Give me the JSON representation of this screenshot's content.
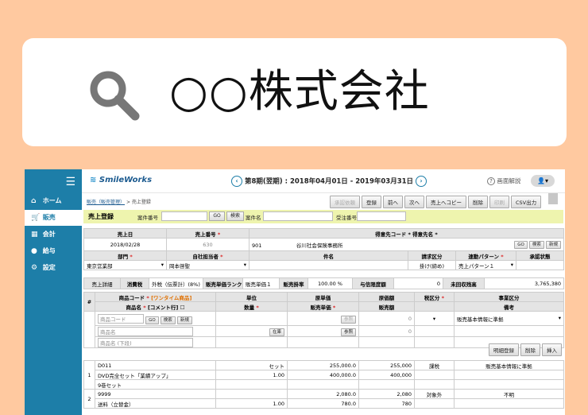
{
  "search": {
    "text": "○○株式会社",
    "icon": "search-icon"
  },
  "sidebar": {
    "items": [
      {
        "label": "ホーム",
        "icon": "home-icon"
      },
      {
        "label": "販売",
        "icon": "cart-icon"
      },
      {
        "label": "会計",
        "icon": "calculator-icon"
      },
      {
        "label": "給与",
        "icon": "money-bag-icon"
      },
      {
        "label": "設定",
        "icon": "gear-icon"
      }
    ]
  },
  "header": {
    "logo": "SmileWorks",
    "period": "第8期(翌期) : 2018年04月01日 - 2019年03月31日",
    "help": "画面解説"
  },
  "breadcrumb": {
    "link": "販売（販売管理）",
    "current": "> 売上登録"
  },
  "toolbar": [
    "承認依頼",
    "登録",
    "前へ",
    "次へ",
    "売上へコピー",
    "削除",
    "印刷",
    "CSV出力"
  ],
  "form": {
    "title": "売上登録",
    "case_no_label": "案件番号",
    "go": "GO",
    "search": "検索",
    "case_name_label": "案件名",
    "order_no_label": "受注番号",
    "sales_date_label": "売上日",
    "sales_date": "2018/02/28",
    "sales_no_label": "売上番号",
    "sales_no": "630",
    "customer_label": "得意先コード * 得意先名 *",
    "customer_code": "901",
    "customer_name": "谷川社会保険事務所",
    "new": "新規",
    "dept_label": "部門",
    "dept": "東京営業部",
    "staff_label": "自社担当者",
    "staff": "岡本啓聖",
    "subject_label": "件名",
    "billing_label": "請求区分",
    "billing": "掛け(締め)",
    "pattern_label": "連動パターン",
    "pattern": "売上パターン１",
    "approval_label": "承認状態",
    "detail_btn": "売上詳細",
    "tax_label": "消費税",
    "tax_value": "外税（伝票計）(8%)",
    "rank_label": "販売単価ランク",
    "rank_value": "販売単価１",
    "rate_label": "販売掛率",
    "rate_value": "100.00 %",
    "credit_label": "与信限度額",
    "credit_value": "0",
    "balance_label": "未回収残高",
    "balance_value": "3,765,380"
  },
  "detail_header": {
    "no": "#",
    "code_label": "商品コード",
    "onetime": "[ワンタイム商品]",
    "name_label": "商品名",
    "comment_label": "[コメント行]",
    "unit": "単位",
    "qty": "数量",
    "price": "原単価",
    "sell_price": "販売単価",
    "cost": "原価額",
    "amount": "販売額",
    "tax_cls": "税区分",
    "biz_cls": "事業区分",
    "note": "備考"
  },
  "entry": {
    "code_ph": "商品コード",
    "name_ph": "商品名",
    "name2_ph": "商品名 (下段)",
    "ref": "参照",
    "stock": "在庫",
    "zero": "0",
    "biz_default": "販売基本情報に準拠"
  },
  "detail_buttons": [
    "明細登録",
    "削除",
    "挿入"
  ],
  "rows": [
    {
      "no": "1",
      "code": "D011",
      "name": "DVD完全セット「業績アップ」",
      "name2": "9巻セット",
      "unit": "セット",
      "qty": "1.00",
      "price": "255,000.0",
      "sell": "400,000.0",
      "cost": "255,000",
      "amount": "400,000",
      "tax": "課税",
      "biz": "販売基本情報に準拠"
    },
    {
      "no": "2",
      "code": "9999",
      "name": "送料（立替金）",
      "name2": "",
      "unit": "",
      "qty": "1.00",
      "price": "2,080.0",
      "sell": "780.0",
      "cost": "2,080",
      "amount": "780",
      "tax": "対象外",
      "biz": "不明"
    }
  ]
}
